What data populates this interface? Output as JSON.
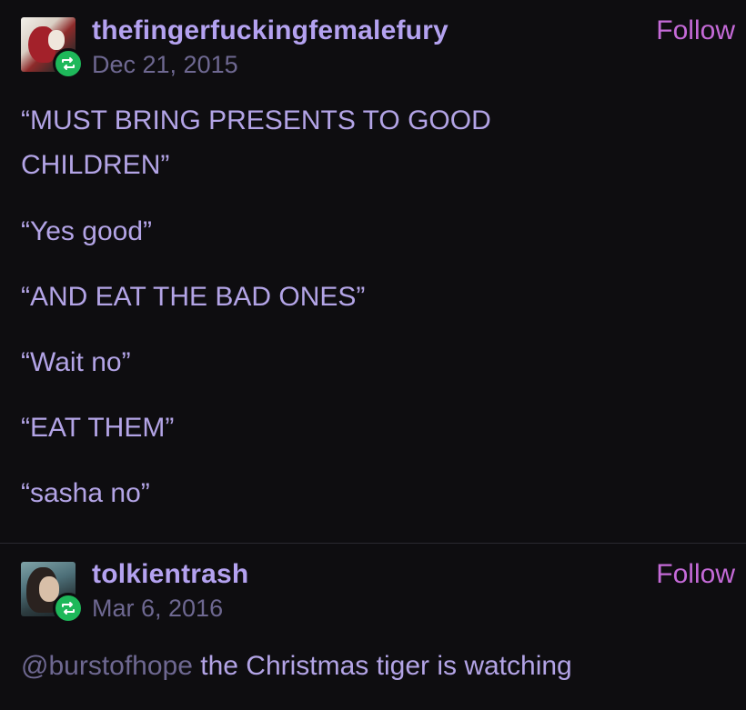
{
  "posts": [
    {
      "username": "thefingerfuckingfemalefury",
      "date": "Dec 21, 2015",
      "follow_label": "Follow",
      "avatar_icon": "avatar-image",
      "badge_icon": "reblog-icon",
      "lines": [
        "“MUST BRING PRESENTS TO GOOD",
        "CHILDREN”",
        "“Yes good”",
        "“AND EAT THE BAD ONES”",
        "“Wait no”",
        "“EAT THEM”",
        "“sasha no”"
      ]
    },
    {
      "username": "tolkientrash",
      "date": "Mar 6, 2016",
      "follow_label": "Follow",
      "avatar_icon": "avatar-image",
      "badge_icon": "reblog-icon",
      "mention": "@burstofhope",
      "body": " the Christmas tiger is watching"
    }
  ],
  "colors": {
    "background": "#0e0d10",
    "username": "#b4a2f0",
    "date": "#6e6891",
    "follow": "#c56ad8",
    "body_text": "#b3a4e6",
    "badge": "#1eb85a"
  }
}
